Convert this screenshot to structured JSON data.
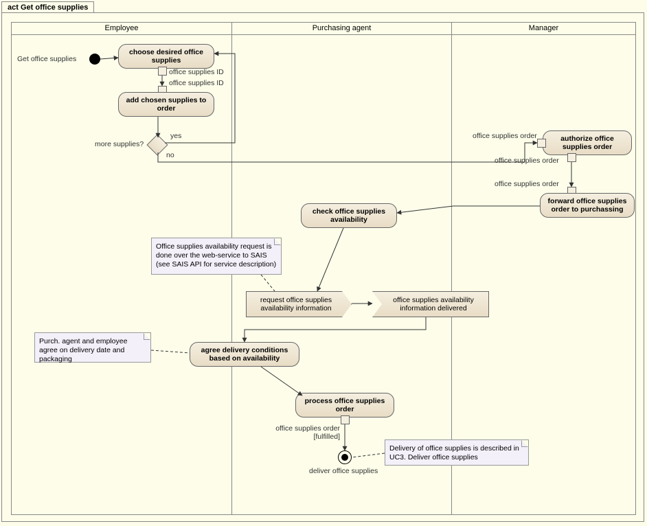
{
  "frame_title": "act Get office supplies",
  "lanes": {
    "l1": "Employee",
    "l2": "Purchasing agent",
    "l3": "Manager"
  },
  "start_label": "Get office supplies",
  "activities": {
    "a1": "choose desired office supplies",
    "a2": "add chosen supplies to order",
    "a3": "authorize office supplies order",
    "a4": "forward office supplies order to purchassing",
    "a5": "check office supplies availability",
    "a6": "agree delivery conditions based on availability",
    "a7": "process office supplies order"
  },
  "signals": {
    "send": "request office supplies availability information",
    "recv": "office supplies availability information delivered"
  },
  "notes": {
    "n1": "Office supplies availability request is done over the web-service to SAIS (see SAIS API for service description)",
    "n2": "Purch. agent and employee agree on delivery date and packaging",
    "n3": "Delivery of office supplies is described in UC3. Deliver office supplies"
  },
  "labels": {
    "pin1a": "office supplies ID",
    "pin1b": "office supplies ID",
    "more": "more supplies?",
    "yes": "yes",
    "no": "no",
    "order1": "office supplies order",
    "order2": "office supplies order",
    "order3": "office supplies order",
    "fulfilled": "office supplies order [fulfilled]",
    "final": "deliver office supplies"
  }
}
